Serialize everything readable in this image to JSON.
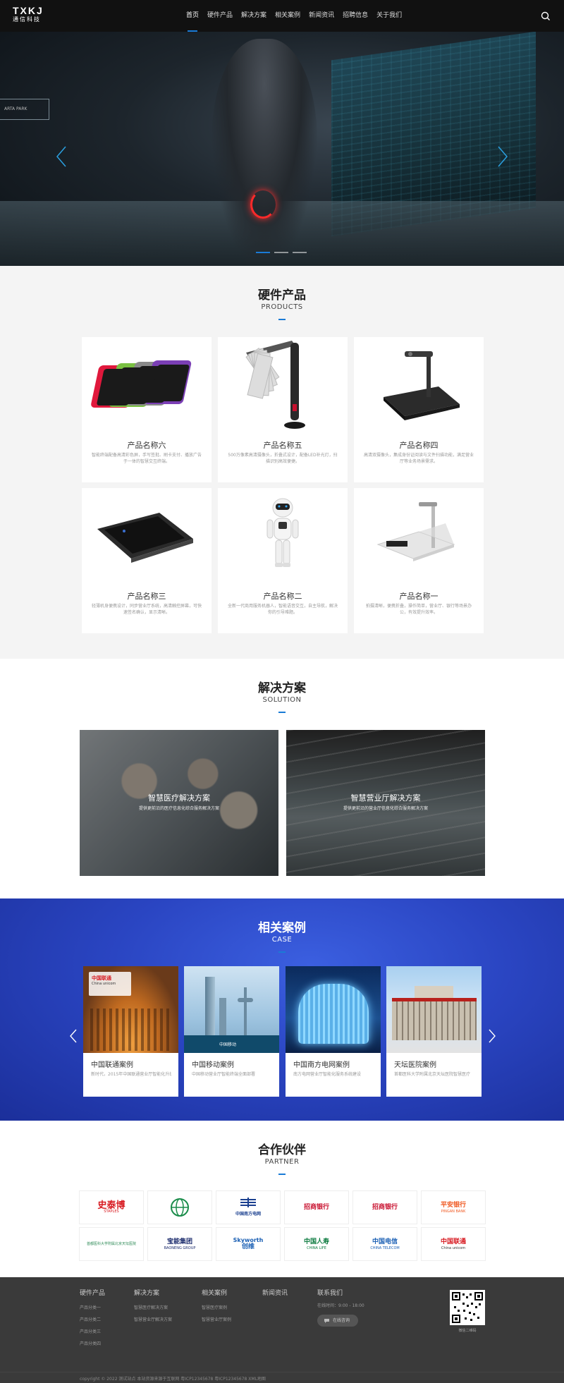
{
  "header": {
    "logo_main": "TXKJ",
    "logo_sub": "通信科技",
    "nav": [
      "首页",
      "硬件产品",
      "解决方案",
      "相关案例",
      "新闻资讯",
      "招聘信息",
      "关于我们"
    ]
  },
  "hero": {
    "sign_text": "ARTA PARK"
  },
  "products": {
    "title_cn": "硬件产品",
    "title_en": "PRODUCTS",
    "items": [
      {
        "name": "产品名称六",
        "desc": "智能终端配备高清彩色屏，手写签批、刷卡支付、播放广告于一体的智慧交互终端。"
      },
      {
        "name": "产品名称五",
        "desc": "500万像素高清摄像头，折叠式设计，配备LED补光灯，扫描识别高效便捷。"
      },
      {
        "name": "产品名称四",
        "desc": "高清双摄像头，集成身份证阅读与文件扫描功能，满足营业厅等业务场景需求。"
      },
      {
        "name": "产品名称三",
        "desc": "轻薄机身便携设计，同步营业厅系统，高清触控屏幕，可快速签名确认，显示清晰。"
      },
      {
        "name": "产品名称二",
        "desc": "全新一代商用服务机器人，智能语音交互，自主导航，解决你的引导难题。"
      },
      {
        "name": "产品名称一",
        "desc": "拍摄清晰，便携折叠，操作简单，营业厅、银行等场景办公，有效提升效率。"
      }
    ]
  },
  "solutions": {
    "title_cn": "解决方案",
    "title_en": "SOLUTION",
    "items": [
      {
        "title": "智慧医疗解决方案",
        "sub": "提供更前沿的医疗信息化综合服务解决方案"
      },
      {
        "title": "智慧营业厅解决方案",
        "sub": "提供更前沿的营业厅信息化综合服务解决方案"
      }
    ]
  },
  "cases": {
    "title_cn": "相关案例",
    "title_en": "CASE",
    "items": [
      {
        "name": "中国联通案例",
        "desc": "新时代，2015年中国联通营业厅智能化升级"
      },
      {
        "name": "中国移动案例",
        "desc": "中国移动营业厅智能终端全面部署"
      },
      {
        "name": "中国南方电网案例",
        "desc": "南方电网营业厅智能化服务系统建设"
      },
      {
        "name": "天坛医院案例",
        "desc": "首都医科大学附属北京天坛医院智慧医疗"
      }
    ],
    "logo_texts": {
      "unicom_cn": "中国联通",
      "unicom_en": "China unicom",
      "mobile": "中国移动"
    }
  },
  "partners": {
    "title_cn": "合作伙伴",
    "title_en": "PARTNER",
    "logos": [
      {
        "text": "史泰博",
        "sub": "STAPLES",
        "color": "#d71920"
      },
      {
        "text": "",
        "sub": "",
        "color": "#1a8c4a"
      },
      {
        "text": "中国南方电网",
        "sub": "",
        "color": "#1a3f8f"
      },
      {
        "text": "招商银行",
        "sub": "",
        "color": "#c8102e"
      },
      {
        "text": "招商银行",
        "sub": "",
        "color": "#c8102e"
      },
      {
        "text": "平安银行",
        "sub": "PINGAN BANK",
        "color": "#f05a23"
      },
      {
        "text": "首都医科大学附属北京天坛医院",
        "sub": "",
        "color": "#2e8b57"
      },
      {
        "text": "宝能集团",
        "sub": "BAONENG GROUP",
        "color": "#1a2a6c"
      },
      {
        "text": "创维",
        "sub": "Skyworth",
        "color": "#1a5fb4"
      },
      {
        "text": "中国人寿",
        "sub": "CHINA LIFE",
        "color": "#0a7a3e"
      },
      {
        "text": "中国电信",
        "sub": "CHINA TELECOM",
        "color": "#1a5fb4"
      },
      {
        "text": "中国联通",
        "sub": "China unicom",
        "color": "#d71920"
      }
    ]
  },
  "footer": {
    "cols": [
      {
        "head": "硬件产品",
        "links": [
          "产品分类一",
          "产品分类二",
          "产品分类三",
          "产品分类四"
        ]
      },
      {
        "head": "解决方案",
        "links": [
          "智慧医疗解决方案",
          "智慧营业厅解决方案"
        ]
      },
      {
        "head": "相关案例",
        "links": [
          "智慧医疗案例",
          "智慧营业厅案例"
        ]
      },
      {
        "head": "新闻资讯",
        "links": []
      }
    ],
    "contact_head": "联系我们",
    "contact_line": "在线时间：9:00 - 18:00",
    "online_label": "在线咨询",
    "qr_label": "微信二维码",
    "copyright": "copyright © 2022 测试站点 本站资源来源于互联网 粤ICP12345678 粤ICP12345678 XML地图"
  },
  "colors": {
    "accent": "#1a7bd6",
    "header_bg": "#111111",
    "footer_bg": "#3a3a3a",
    "cases_bg": "#2a45c2"
  }
}
